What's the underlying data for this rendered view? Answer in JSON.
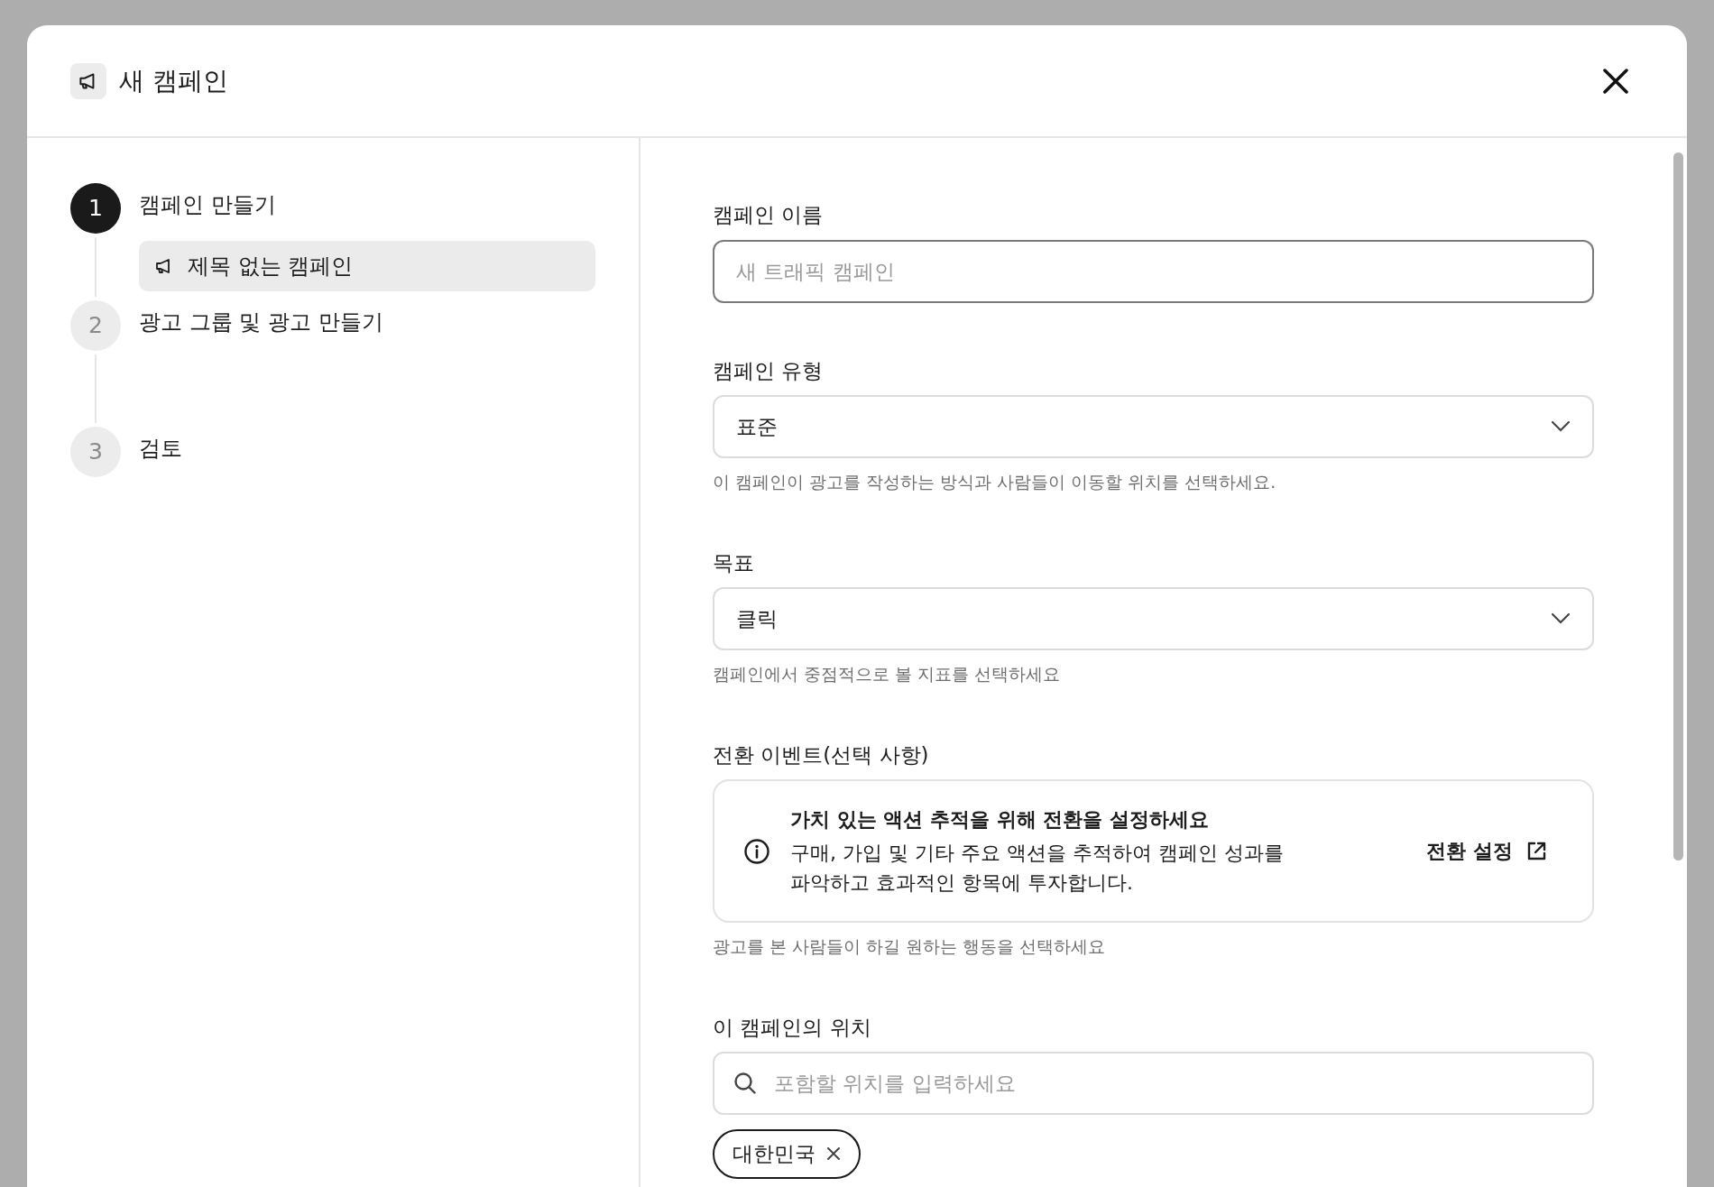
{
  "dialog": {
    "title": "새 캠페인"
  },
  "steps": [
    {
      "number": "1",
      "label": "캠페인 만들기",
      "active": true,
      "children": [
        {
          "label": "제목 없는 캠페인",
          "selected": true
        }
      ]
    },
    {
      "number": "2",
      "label": "광고 그룹 및 광고 만들기",
      "active": false
    },
    {
      "number": "3",
      "label": "검토",
      "active": false
    }
  ],
  "form": {
    "fields": [
      {
        "kind": "text",
        "label": "캠페인 이름",
        "placeholder": "새 트래픽 캠페인",
        "focused": true
      },
      {
        "kind": "select",
        "label": "캠페인 유형",
        "value": "표준",
        "help": "이 캠페인이 광고를 작성하는 방식과 사람들이 이동할 위치를 선택하세요."
      },
      {
        "kind": "select",
        "label": "목표",
        "value": "클릭",
        "help": "캠페인에서 중점적으로 볼 지표를 선택하세요"
      },
      {
        "kind": "notice",
        "label": "전환 이벤트(선택 사항)",
        "title": "가치 있는 액션 추적을 위해 전환을 설정하세요",
        "body": "구매, 가입 및 기타 주요 액션을 추적하여 캠페인 성과를 파악하고 효과적인 항목에 투자합니다.",
        "action": "전환 설정",
        "help": "광고를 본 사람들이 하길 원하는 행동을 선택하세요"
      },
      {
        "kind": "search",
        "label": "이 캠페인의 위치",
        "placeholder": "포함할 위치를 입력하세요",
        "tags": [
          {
            "label": "대한민국"
          }
        ]
      }
    ]
  }
}
